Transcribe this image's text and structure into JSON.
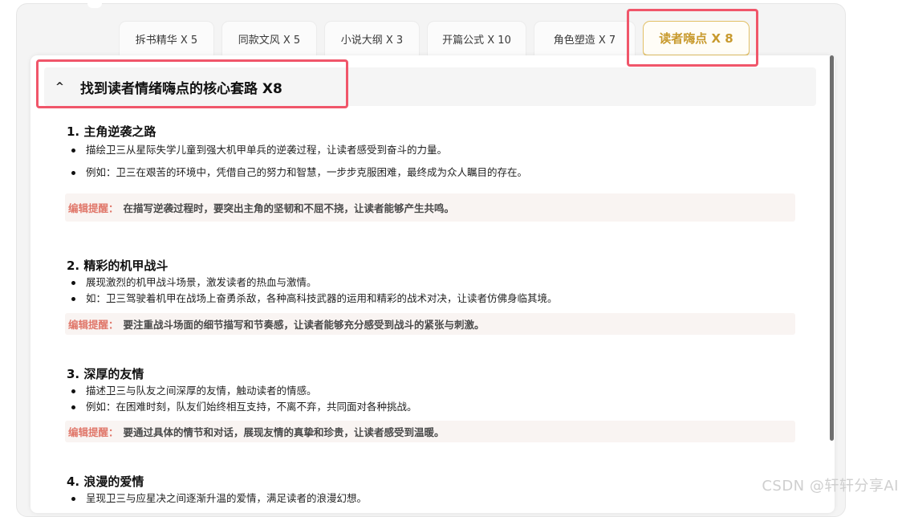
{
  "tabs": [
    {
      "label": "拆书精华 X 5",
      "active": false
    },
    {
      "label": "同款文风 X 5",
      "active": false
    },
    {
      "label": "小说大纲 X 3",
      "active": false
    },
    {
      "label": "开篇公式 X 10",
      "active": false
    },
    {
      "label": "角色塑造 X 7",
      "active": false
    },
    {
      "label": "读者嗨点 X 8",
      "active": true
    }
  ],
  "section": {
    "caret": "^",
    "title": "找到读者情绪嗨点的核心套路 X8"
  },
  "items": [
    {
      "title": "1. 主角逆袭之路",
      "bullets": [
        "描绘卫三从星际失学儿童到强大机甲单兵的逆袭过程，让读者感受到奋斗的力量。",
        "例如：卫三在艰苦的环境中，凭借自己的努力和智慧，一步步克服困难，最终成为众人瞩目的存在。"
      ],
      "tip_label": "编辑提醒：",
      "tip_text": "在描写逆袭过程时，要突出主角的坚韧和不屈不挠，让读者能够产生共鸣。"
    },
    {
      "title": "2. 精彩的机甲战斗",
      "bullets": [
        "展现激烈的机甲战斗场景，激发读者的热血与激情。",
        "如：卫三驾驶着机甲在战场上奋勇杀敌，各种高科技武器的运用和精彩的战术对决，让读者仿佛身临其境。"
      ],
      "tip_label": "编辑提醒：",
      "tip_text": "要注重战斗场面的细节描写和节奏感，让读者能够充分感受到战斗的紧张与刺激。"
    },
    {
      "title": "3. 深厚的友情",
      "bullets": [
        "描述卫三与队友之间深厚的友情，触动读者的情感。",
        "例如：在困难时刻，队友们始终相互支持，不离不弃，共同面对各种挑战。"
      ],
      "tip_label": "编辑提醒：",
      "tip_text": "要通过具体的情节和对话，展现友情的真挚和珍贵，让读者感受到温暖。"
    },
    {
      "title": "4. 浪漫的爱情",
      "bullets": [
        "呈现卫三与应星决之间逐渐升温的爱情，满足读者的浪漫幻想。"
      ]
    }
  ],
  "watermark": "CSDN @轩轩分享AI",
  "colors": {
    "accent_gold": "#c89a2e",
    "highlight_red": "#f0566a",
    "tip_label": "#e0776a",
    "tip_bg": "#f9f4f2"
  }
}
